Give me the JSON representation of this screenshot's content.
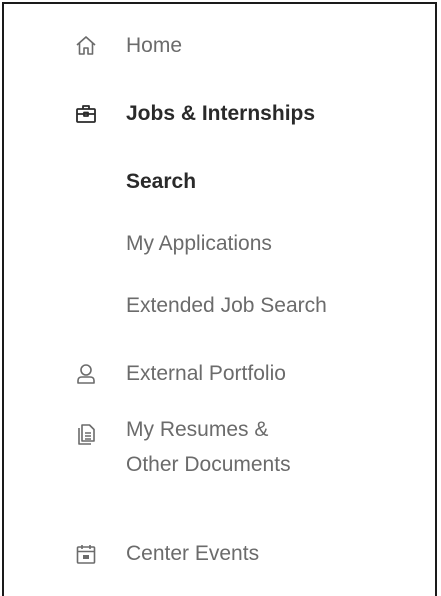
{
  "nav": {
    "home": {
      "label": "Home",
      "icon": "home-icon"
    },
    "jobs": {
      "label": "Jobs & Internships",
      "icon": "briefcase-icon"
    },
    "search": {
      "label": "Search"
    },
    "applications": {
      "label": "My Applications"
    },
    "extended_search": {
      "label": "Extended Job Search"
    },
    "portfolio": {
      "label": "External Portfolio",
      "icon": "person-icon"
    },
    "resumes": {
      "label_line1": "My Resumes &",
      "label_line2": "Other Documents",
      "icon": "documents-icon"
    },
    "events": {
      "label": "Center Events",
      "icon": "calendar-icon"
    }
  },
  "colors": {
    "text": "#6b6b6b",
    "active_text": "#2a2a2a",
    "border": "#1a1a1a"
  }
}
